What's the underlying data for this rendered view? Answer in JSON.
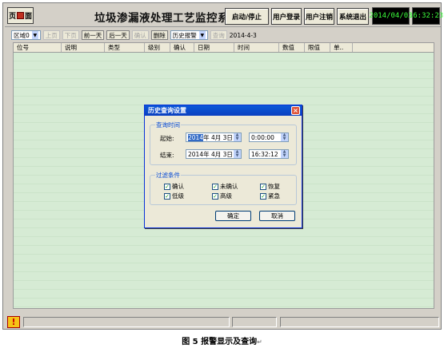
{
  "header": {
    "page_icon_text": "页",
    "page_icon_text2": "面",
    "title": "垃圾渗漏液处理工艺监控系统",
    "btn_start_stop": "启动/停止",
    "btn_login": "用户登录",
    "btn_logout": "用户注销",
    "btn_exit": "系统退出",
    "date": "2014/04/03",
    "time": "16:32:23"
  },
  "toolbar": {
    "area_select": "区域0",
    "prev_page": "上页",
    "next_page": "下页",
    "prev_day": "前一天",
    "next_day": "后一天",
    "confirm": "确认",
    "delete": "删除",
    "history_select": "历史报警",
    "query": "查询",
    "date": "2014-4-3"
  },
  "table": {
    "columns": [
      "位号",
      "说明",
      "类型",
      "级别",
      "确认",
      "日期",
      "时间",
      "数值",
      "限值",
      "单.."
    ]
  },
  "dialog": {
    "title": "历史查询设置",
    "close": "×",
    "group_time": "查询时间",
    "start_label": "起始:",
    "start_year": "2014",
    "start_date_rest": "年 4月 3日",
    "start_time": "0:00:00",
    "end_label": "结束:",
    "end_date": "2014年 4月 3日",
    "end_time": "16:32:12",
    "group_filter": "过滤条件",
    "filters": [
      {
        "label": "确认",
        "checked": true
      },
      {
        "label": "未确认",
        "checked": true
      },
      {
        "label": "恢复",
        "checked": true
      },
      {
        "label": "低级",
        "checked": true
      },
      {
        "label": "高级",
        "checked": true
      },
      {
        "label": "紧急",
        "checked": true
      }
    ],
    "ok": "确定",
    "cancel": "取消"
  },
  "status": {
    "alarm_icon": "!"
  },
  "caption": {
    "text": "图 5  报警显示及查询",
    "mark": "↵"
  }
}
